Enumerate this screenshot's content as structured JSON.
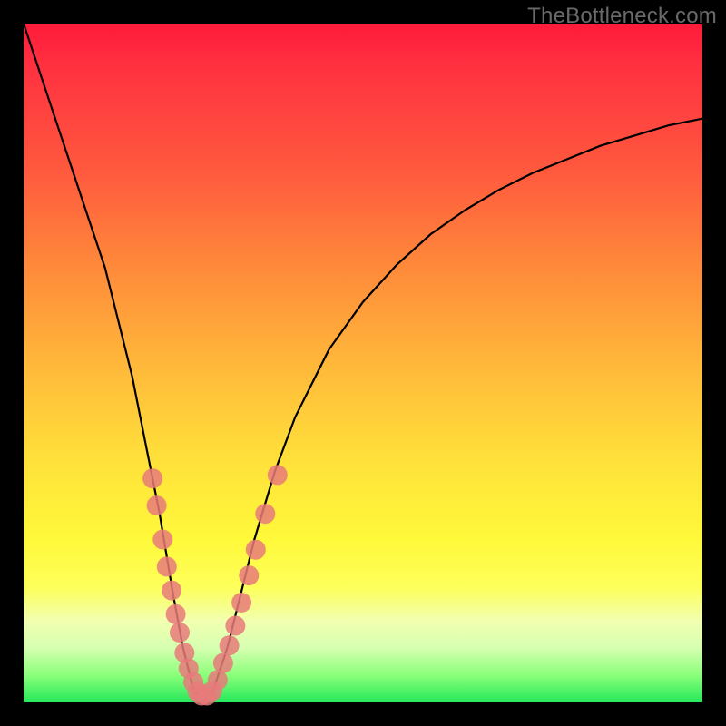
{
  "watermark": {
    "text": "TheBottleneck.com"
  },
  "chart_data": {
    "type": "line",
    "title": "",
    "xlabel": "",
    "ylabel": "",
    "xlim": [
      0,
      100
    ],
    "ylim": [
      0,
      100
    ],
    "series": [
      {
        "name": "bottleneck-curve",
        "x": [
          0,
          4,
          8,
          12,
          16,
          18,
          20,
          22,
          23.5,
          25,
          26.5,
          28,
          30,
          32,
          34,
          37,
          40,
          45,
          50,
          55,
          60,
          65,
          70,
          75,
          80,
          85,
          90,
          95,
          100
        ],
        "y": [
          100,
          88,
          76,
          64,
          48,
          38,
          28,
          16,
          8,
          2,
          0,
          2,
          8,
          16,
          24,
          34,
          42,
          52,
          59,
          64.5,
          69,
          72.5,
          75.5,
          78,
          80,
          82,
          83.5,
          85,
          86
        ]
      }
    ],
    "markers": [
      {
        "name": "left-markers",
        "color": "#e87a7a",
        "points": [
          {
            "x": 19.0,
            "y": 33
          },
          {
            "x": 19.6,
            "y": 29
          },
          {
            "x": 20.5,
            "y": 24
          },
          {
            "x": 21.1,
            "y": 20
          },
          {
            "x": 21.8,
            "y": 16.5
          },
          {
            "x": 22.4,
            "y": 13
          },
          {
            "x": 23.0,
            "y": 10.3
          },
          {
            "x": 23.7,
            "y": 7.3
          },
          {
            "x": 24.3,
            "y": 5
          },
          {
            "x": 25.0,
            "y": 3
          },
          {
            "x": 25.6,
            "y": 1.6
          },
          {
            "x": 26.2,
            "y": 1.0
          },
          {
            "x": 27.0,
            "y": 1.0
          },
          {
            "x": 27.8,
            "y": 1.7
          }
        ]
      },
      {
        "name": "right-markers",
        "color": "#e87a7a",
        "points": [
          {
            "x": 28.6,
            "y": 3.3
          },
          {
            "x": 29.4,
            "y": 5.8
          },
          {
            "x": 30.3,
            "y": 8.4
          },
          {
            "x": 31.2,
            "y": 11.3
          },
          {
            "x": 32.1,
            "y": 14.7
          },
          {
            "x": 33.2,
            "y": 18.7
          },
          {
            "x": 34.2,
            "y": 22.5
          },
          {
            "x": 35.6,
            "y": 27.8
          },
          {
            "x": 37.4,
            "y": 33.5
          }
        ]
      }
    ],
    "gradient_stops": [
      {
        "pos": 0,
        "color": "#ff1a3a"
      },
      {
        "pos": 50,
        "color": "#ffb73a"
      },
      {
        "pos": 80,
        "color": "#fdff5a"
      },
      {
        "pos": 100,
        "color": "#25e85a"
      }
    ]
  }
}
